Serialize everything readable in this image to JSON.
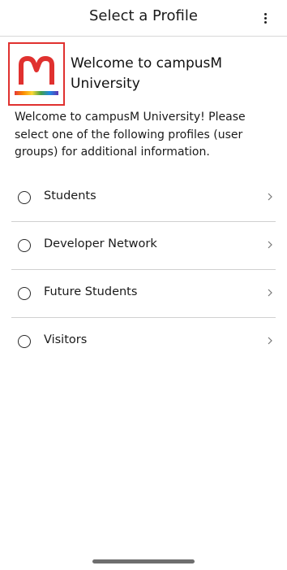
{
  "header": {
    "title": "Select a Profile",
    "menu_icon": "more-vertical-icon"
  },
  "welcome": {
    "logo_letter": "M",
    "logo_color": "#e0312f",
    "highlight_color": "#e0312f",
    "title": "Welcome to campusM University",
    "body": "Welcome to campusM University! Please select one of the following profiles (user groups) for additional information."
  },
  "profiles": [
    {
      "label": "Students"
    },
    {
      "label": "Developer Network"
    },
    {
      "label": "Future Students"
    },
    {
      "label": "Visitors"
    }
  ],
  "icons": {
    "radio": "radio-unselected-icon",
    "chevron": "chevron-right-icon"
  }
}
